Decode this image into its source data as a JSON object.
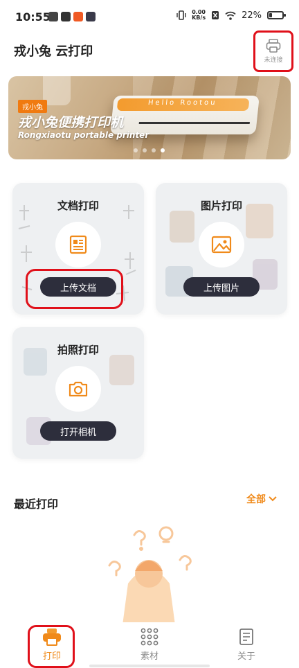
{
  "status_bar": {
    "time": "10:55",
    "net_speed_value": "0.00",
    "net_speed_unit": "KB/s",
    "battery_percent": "22%",
    "battery_level": 0.22
  },
  "header": {
    "title": "戎小兔 云打印",
    "printer_status_label": "未连接"
  },
  "banner": {
    "tag": "戎小兔",
    "headline": "戎小兔便携打印机",
    "subline": "Rongxiaotu portable printer",
    "product_brand": "Hello Rootou",
    "slides": 4,
    "active_slide": 4
  },
  "cards": {
    "document": {
      "title": "文档打印",
      "action": "上传文档"
    },
    "image": {
      "title": "图片打印",
      "action": "上传图片"
    },
    "camera": {
      "title": "拍照打印",
      "action": "打开相机"
    }
  },
  "recent": {
    "title": "最近打印",
    "all_label": "全部"
  },
  "tabs": [
    {
      "label": "打印",
      "active": true
    },
    {
      "label": "素材",
      "active": false
    },
    {
      "label": "关于",
      "active": false
    }
  ],
  "colors": {
    "accent": "#f08a1a",
    "highlight": "#e0101a",
    "button_dark": "#2d2e3c"
  }
}
